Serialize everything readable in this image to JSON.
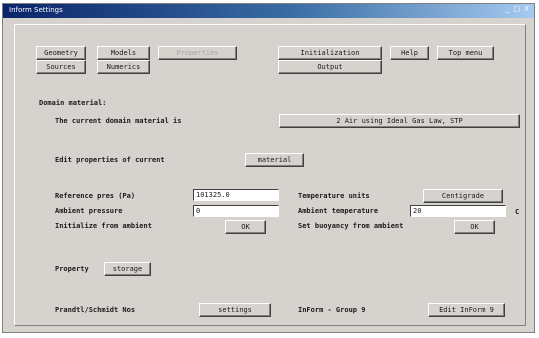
{
  "window": {
    "title": "Inform Settings",
    "controls": "_ □ X"
  },
  "nav": {
    "geometry": "Geometry",
    "models": "Models",
    "properties": "Properties",
    "initialization": "Initialization",
    "help": "Help",
    "top_menu": "Top menu",
    "sources": "Sources",
    "numerics": "Numerics",
    "output": "Output"
  },
  "domain": {
    "heading": "Domain material:",
    "current_label": "The current domain material is",
    "current_value": "2   Air using Ideal Gas Law, STP",
    "edit_label": "Edit properties of current",
    "edit_button": "material"
  },
  "reference": {
    "ref_pres_label": "Reference pres (Pa)",
    "ref_pres_value": "101325.0",
    "temp_units_label": "Temperature units",
    "temp_units_value": "Centigrade",
    "ambient_pres_label": "Ambient pressure",
    "ambient_pres_value": "0",
    "ambient_temp_label": "Ambient temperature",
    "ambient_temp_value": "20",
    "ambient_temp_unit": "C",
    "init_ambient_label": "Initialize from ambient",
    "init_ambient_button": "OK",
    "buoyancy_label": "Set buoyancy from ambient",
    "buoyancy_button": "OK"
  },
  "property": {
    "label": "Property",
    "storage_button": "storage"
  },
  "prandtl": {
    "label": "Prandtl/Schmidt Nos",
    "settings_button": "settings",
    "inform_label": "InForm - Group 9",
    "edit_inform_button": "Edit InForm 9"
  }
}
